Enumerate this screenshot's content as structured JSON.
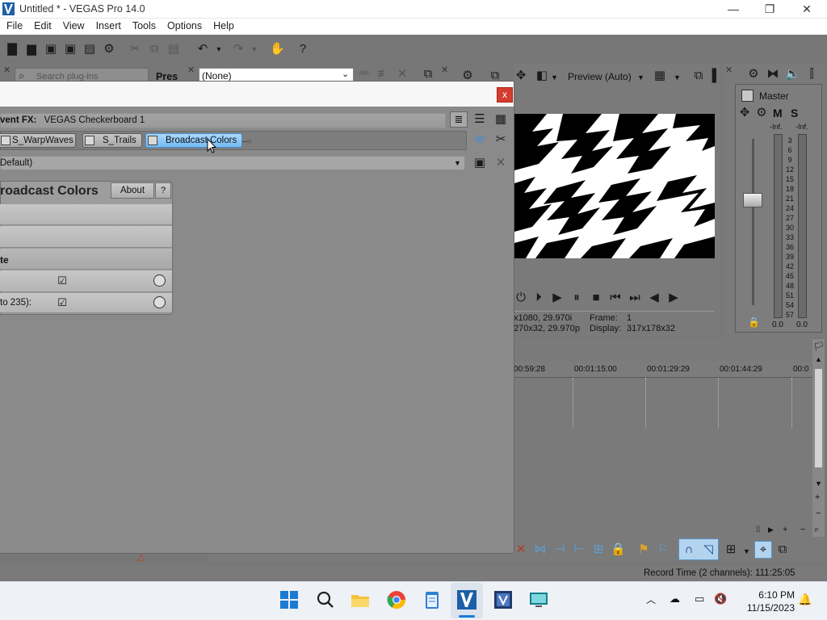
{
  "window": {
    "title": "Untitled * - VEGAS Pro 14.0",
    "minimize": "—",
    "restore": "❐",
    "close": "✕"
  },
  "menu": [
    "File",
    "Edit",
    "View",
    "Insert",
    "Tools",
    "Options",
    "Help"
  ],
  "plugin_search": {
    "placeholder": "Search plug-ins",
    "presets_label": "Pres"
  },
  "preset_top": {
    "value": "(None)"
  },
  "preview": {
    "mode": "Preview (Auto)",
    "info_line1_left": "x1080, 29.970i",
    "info_line1_right_label": "Frame:",
    "info_line1_right_value": "1",
    "info_line2_left": "270x32, 29.970p",
    "info_line2_right_label": "Display:",
    "info_line2_right_value": "317x178x32"
  },
  "master": {
    "title": "Master",
    "m_label": "M",
    "s_label": "S",
    "inf_left": "-Inf.",
    "inf_right": "-Inf.",
    "scale": [
      "3",
      "6",
      "9",
      "12",
      "15",
      "18",
      "21",
      "24",
      "27",
      "30",
      "33",
      "36",
      "39",
      "42",
      "45",
      "48",
      "51",
      "54",
      "57"
    ],
    "level_left": "0.0",
    "level_right": "0.0"
  },
  "timeline": {
    "ticks": [
      "00:59:28",
      "00:01:15:00",
      "00:01:29:29",
      "00:01:44:29",
      "00:0"
    ]
  },
  "status": {
    "record_time": "Record Time (2 channels): 111:25:05"
  },
  "dialog": {
    "close": "x",
    "fx_label": "vent FX:",
    "fx_name": "VEGAS Checkerboard 1",
    "chain": [
      {
        "label": "S_WarpWaves",
        "checked": true,
        "active": false
      },
      {
        "label": "S_Trails",
        "checked": true,
        "active": false
      },
      {
        "label": "Broadcast Colors",
        "checked": true,
        "active": true
      }
    ],
    "preset": "Default)",
    "plugin": {
      "title": "roadcast Colors",
      "about": "About",
      "help": "?",
      "section": "te",
      "row2_label": "to 235):",
      "check_mark": "☑"
    }
  },
  "taskbar": {
    "time": "6:10 PM",
    "date": "11/15/2023",
    "apps": [
      "windows-start-icon",
      "search-icon",
      "file-explorer-icon",
      "chrome-icon",
      "notepad-icon",
      "vegas-pro-icon",
      "vegas-alt-icon",
      "remote-desktop-icon"
    ]
  }
}
